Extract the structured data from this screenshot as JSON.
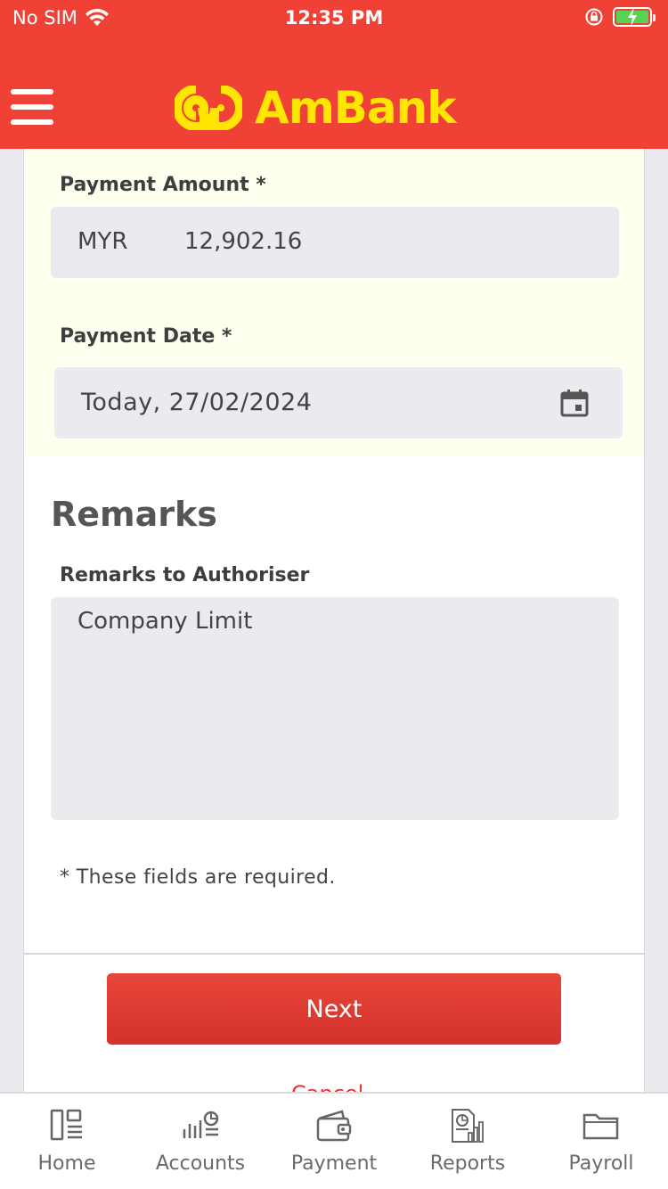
{
  "status_bar": {
    "carrier": "No SIM",
    "time": "12:35 PM"
  },
  "header": {
    "brand": "AmBank",
    "colors": {
      "background": "#ef4135",
      "logo": "#ffe600"
    }
  },
  "form": {
    "payment_amount": {
      "label": "Payment Amount *",
      "currency": "MYR",
      "value": "12,902.16"
    },
    "payment_date": {
      "label": "Payment Date *",
      "value": "Today, 27/02/2024",
      "icon": "calendar-icon"
    },
    "remarks": {
      "section_title": "Remarks",
      "label": "Remarks to Authoriser",
      "value": "Company Limit"
    },
    "required_note": "* These fields are required.",
    "next_label": "Next",
    "cancel_label": "Cancel"
  },
  "tabbar": {
    "items": [
      {
        "label": "Home",
        "icon": "home-icon"
      },
      {
        "label": "Accounts",
        "icon": "accounts-icon"
      },
      {
        "label": "Payment",
        "icon": "wallet-icon"
      },
      {
        "label": "Reports",
        "icon": "reports-icon"
      },
      {
        "label": "Payroll",
        "icon": "folder-icon"
      }
    ]
  }
}
